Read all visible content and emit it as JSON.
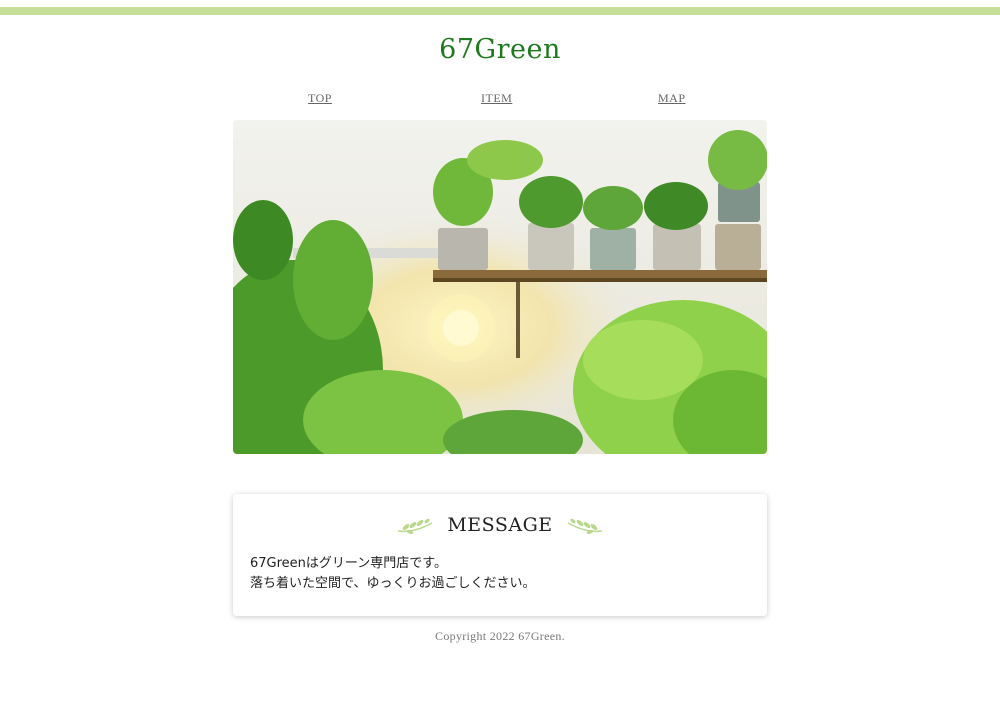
{
  "site": {
    "title": "67Green",
    "accent_color": "#c5df98",
    "title_color": "#1f7a1f"
  },
  "nav": {
    "items": [
      {
        "label": "TOP"
      },
      {
        "label": "ITEM"
      },
      {
        "label": "MAP"
      }
    ]
  },
  "hero": {
    "image": "photo-shelf-with-potted-plants-and-ferns"
  },
  "message": {
    "heading": "MESSAGE",
    "icons": [
      "leaf-sprig-icon",
      "leaf-sprig-icon"
    ],
    "lines": [
      "67Greenはグリーン専門店です。",
      "落ち着いた空間で、ゆっくりお過ごしください。"
    ]
  },
  "footer": {
    "copyright": "Copyright 2022 67Green."
  }
}
